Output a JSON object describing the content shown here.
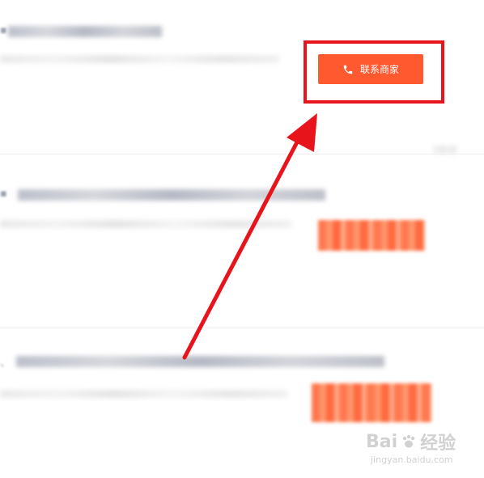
{
  "contact_button": {
    "label": "联系商家",
    "icon": "phone-icon"
  },
  "highlight": {
    "box_color": "#e8141b",
    "arrow_color": "#e8141b"
  },
  "colors": {
    "button_bg": "#ff5a2f",
    "button_text": "#ffffff"
  },
  "watermark": {
    "brand": "Bai",
    "brand_suffix": "经验",
    "url": "jingyan.baidu.com",
    "icon": "baidu-paw-icon"
  }
}
